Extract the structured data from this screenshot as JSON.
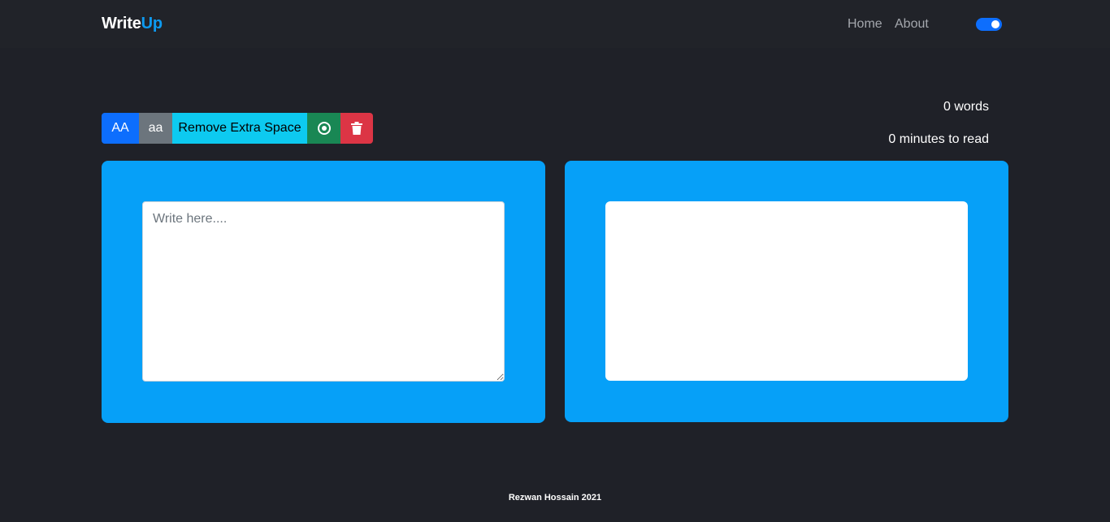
{
  "navbar": {
    "brand_part1": "Write",
    "brand_part2": "Up",
    "links": [
      {
        "label": "Home"
      },
      {
        "label": "About"
      }
    ],
    "dark_mode_toggle": {
      "checked": true
    }
  },
  "toolbar": {
    "uppercase_label": "AA",
    "lowercase_label": "aa",
    "remove_space_label": "Remove Extra Space",
    "speak_icon": "record-circle-icon",
    "delete_icon": "trash-icon"
  },
  "stats": {
    "words": "0 words",
    "read_time": "0 minutes to read"
  },
  "editor": {
    "placeholder": "Write here....",
    "value": ""
  },
  "preview": {
    "text": ""
  },
  "footer": {
    "text": "Rezwan Hossain 2021"
  },
  "colors": {
    "background": "#1f2128",
    "navbar": "#212329",
    "brand_accent": "#0d9af0",
    "panel": "#06a0f8",
    "primary": "#0d6efd",
    "secondary": "#6c757d",
    "info": "#0dcaf0",
    "success": "#198754",
    "danger": "#dc3545"
  }
}
